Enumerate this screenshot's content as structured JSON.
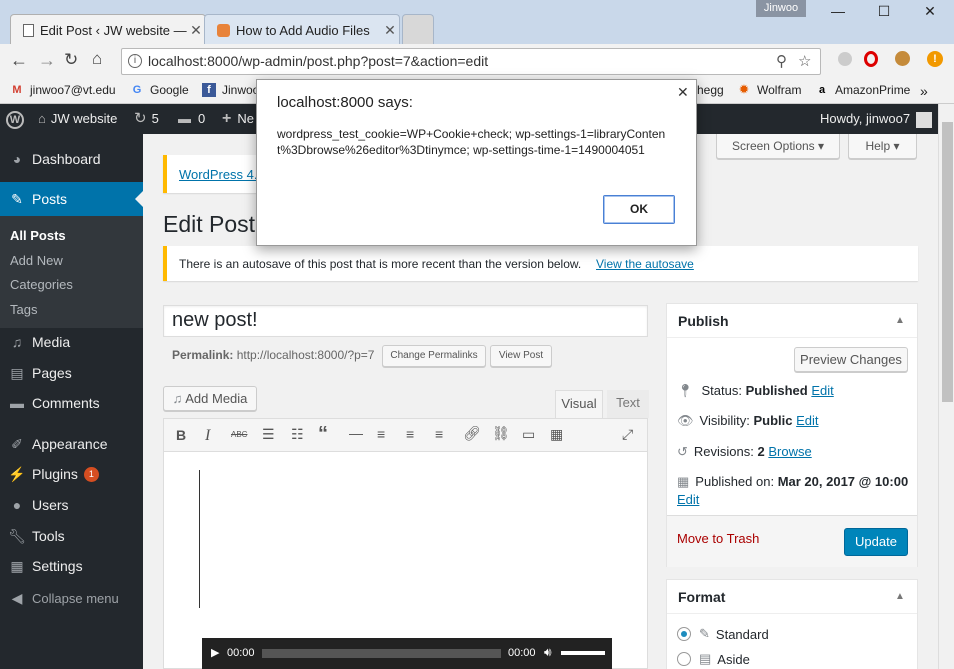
{
  "browser": {
    "tabs": [
      {
        "title": "Edit Post ‹ JW website —",
        "active": true
      },
      {
        "title": "How to Add Audio Files",
        "active": false
      }
    ],
    "profile_name": "Jinwoo",
    "url": "localhost:8000/wp-admin/post.php?post=7&action=edit",
    "bookmarks": [
      "jinwoo7@vt.edu",
      "Google",
      "Jinwoo",
      "hegg",
      "Wolfram",
      "AmazonPrime"
    ],
    "bookmarks_more": "»"
  },
  "adminbar": {
    "site": "JW website",
    "updates": "5",
    "comments": "0",
    "new": "Ne",
    "howdy": "Howdy, jinwoo7"
  },
  "sidebar": {
    "items": [
      {
        "label": "Dashboard",
        "icon": "dashboard-icon"
      },
      {
        "label": "Posts",
        "icon": "pin-icon"
      },
      {
        "label": "Media",
        "icon": "media-icon"
      },
      {
        "label": "Pages",
        "icon": "pages-icon"
      },
      {
        "label": "Comments",
        "icon": "comment-icon"
      },
      {
        "label": "Appearance",
        "icon": "brush-icon"
      },
      {
        "label": "Plugins",
        "icon": "plugin-icon",
        "badge": "1"
      },
      {
        "label": "Users",
        "icon": "user-icon"
      },
      {
        "label": "Tools",
        "icon": "wrench-icon"
      },
      {
        "label": "Settings",
        "icon": "settings-icon"
      }
    ],
    "submenu": [
      "All Posts",
      "Add New",
      "Categories",
      "Tags"
    ],
    "collapse": "Collapse menu"
  },
  "screen": {
    "screen_options": "Screen Options",
    "help": "Help",
    "update_notice": "WordPress 4.",
    "heading": "Edit Post",
    "autosave_text": "There is an autosave of this post that is more recent than the version below.",
    "autosave_link": "View the autosave",
    "title_value": "new post!",
    "permalink_label": "Permalink:",
    "permalink_url": "http://localhost:8000/?p=7",
    "change_permalinks": "Change Permalinks",
    "view_post": "View Post",
    "add_media": "Add Media",
    "tab_visual": "Visual",
    "tab_text": "Text",
    "audio": {
      "current": "00:00",
      "duration": "00:00"
    }
  },
  "publish": {
    "title": "Publish",
    "preview": "Preview Changes",
    "status_label": "Status:",
    "status_value": "Published",
    "visibility_label": "Visibility:",
    "visibility_value": "Public",
    "revisions_label": "Revisions:",
    "revisions_value": "2",
    "browse": "Browse",
    "published_label": "Published on:",
    "published_value": "Mar 20, 2017 @ 10:00",
    "edit": "Edit",
    "trash": "Move to Trash",
    "update": "Update"
  },
  "format": {
    "title": "Format",
    "options": [
      {
        "label": "Standard",
        "checked": true
      },
      {
        "label": "Aside",
        "checked": false
      }
    ]
  },
  "dialog": {
    "title": "localhost:8000 says:",
    "message": "wordpress_test_cookie=WP+Cookie+check; wp-settings-1=libraryContent%3Dbrowse%26editor%3Dtinymce; wp-settings-time-1=1490004051",
    "ok": "OK"
  },
  "colors": {
    "wp_blue": "#0073aa",
    "admin_dark": "#23282d",
    "notice_yellow": "#ffb900",
    "trash_red": "#a00"
  }
}
